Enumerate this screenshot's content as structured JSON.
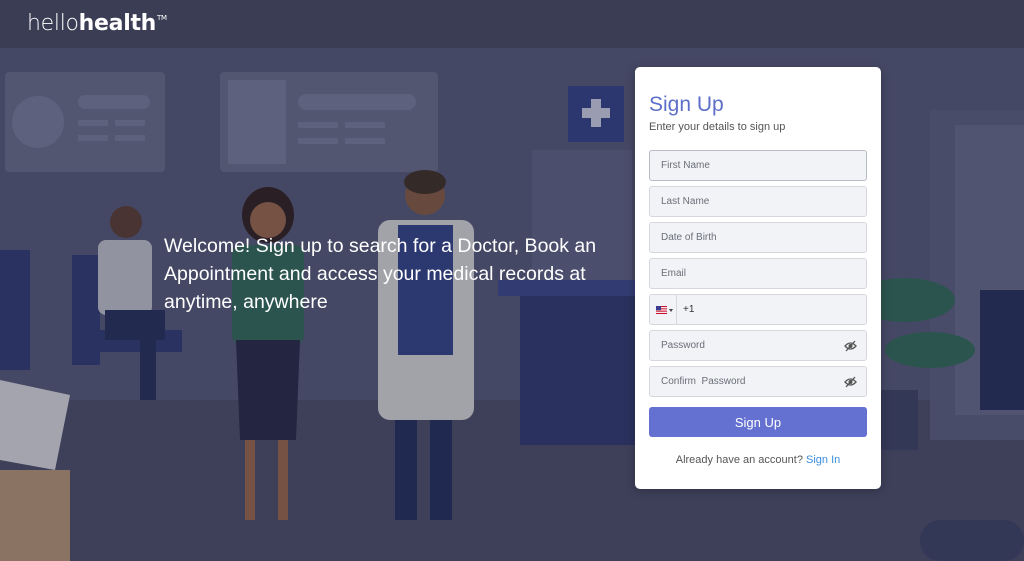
{
  "header": {
    "logo_light": "hello",
    "logo_bold": "health",
    "logo_tm": "TM"
  },
  "welcome": {
    "text": "Welcome! Sign up to search for a Doctor, Book an Appointment and access your medical records at anytime, anywhere"
  },
  "form": {
    "title": "Sign Up",
    "subtitle": "Enter your details to sign up",
    "first_name_placeholder": "First Name",
    "last_name_placeholder": "Last Name",
    "dob_placeholder": "Date of Birth",
    "email_placeholder": "Email",
    "phone_code": "+1",
    "password_placeholder": "Password",
    "confirm_password_placeholder": "Confirm  Password",
    "submit_label": "Sign Up",
    "already_text": "Already have an account?",
    "signin_link": "Sign In"
  },
  "colors": {
    "accent": "#6471d0",
    "title": "#5d6fc8",
    "link": "#3a8ee0",
    "topbar": "#3b3d55"
  }
}
